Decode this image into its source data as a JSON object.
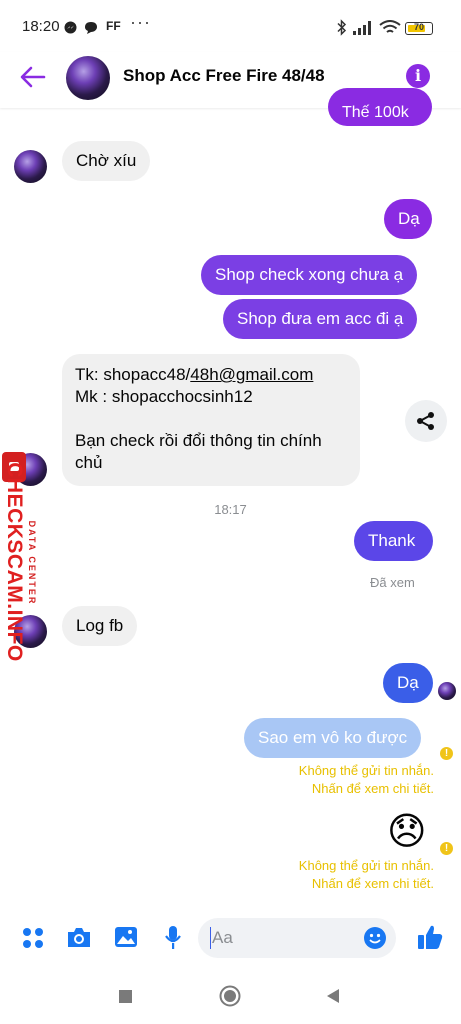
{
  "status_bar": {
    "time": "18:20",
    "carrier_tag": "FF",
    "more": "···",
    "battery": "70"
  },
  "header": {
    "title": "Shop Acc Free Fire 48/48",
    "back_icon": "back-arrow-icon",
    "info_icon": "info-icon",
    "accent": "#8a2be2"
  },
  "messages": {
    "partial_top": "Thế 100k",
    "m1": "Chờ xíu",
    "m2": "Dạ",
    "m3": "Shop check xong chưa ạ",
    "m4": "Shop đưa em acc đi ạ",
    "m5": {
      "line1_prefix": "Tk: shopacc48/",
      "line1_link": "48h@gmail.com",
      "line2": "Mk : shopacchocsinh12",
      "line3": "Bạn check rồi đổi thông tin chính",
      "line4": "chủ"
    },
    "timestamp": "18:17",
    "m6": "Thank",
    "seen": "Đã xem",
    "m7": "Log fb",
    "m8": "Dạ",
    "m9": "Sao em vô ko được",
    "fail1_line1": "Không thể gửi tin nhắn.",
    "fail1_line2": "Nhấn để xem chi tiết.",
    "emoji": "😞",
    "fail2_line1": "Không thể gửi tin nhắn.",
    "fail2_line2": "Nhấn để xem chi tiết.",
    "warn_glyph": "!"
  },
  "composer": {
    "placeholder": "Aa"
  },
  "watermark": {
    "line1": "DATA CENTER",
    "line2": "CHECKSCAM.INFO"
  },
  "colors": {
    "incoming": "#f0f0f0",
    "outgoing_blue": "#3a5ee8",
    "warning": "#e8c000"
  }
}
